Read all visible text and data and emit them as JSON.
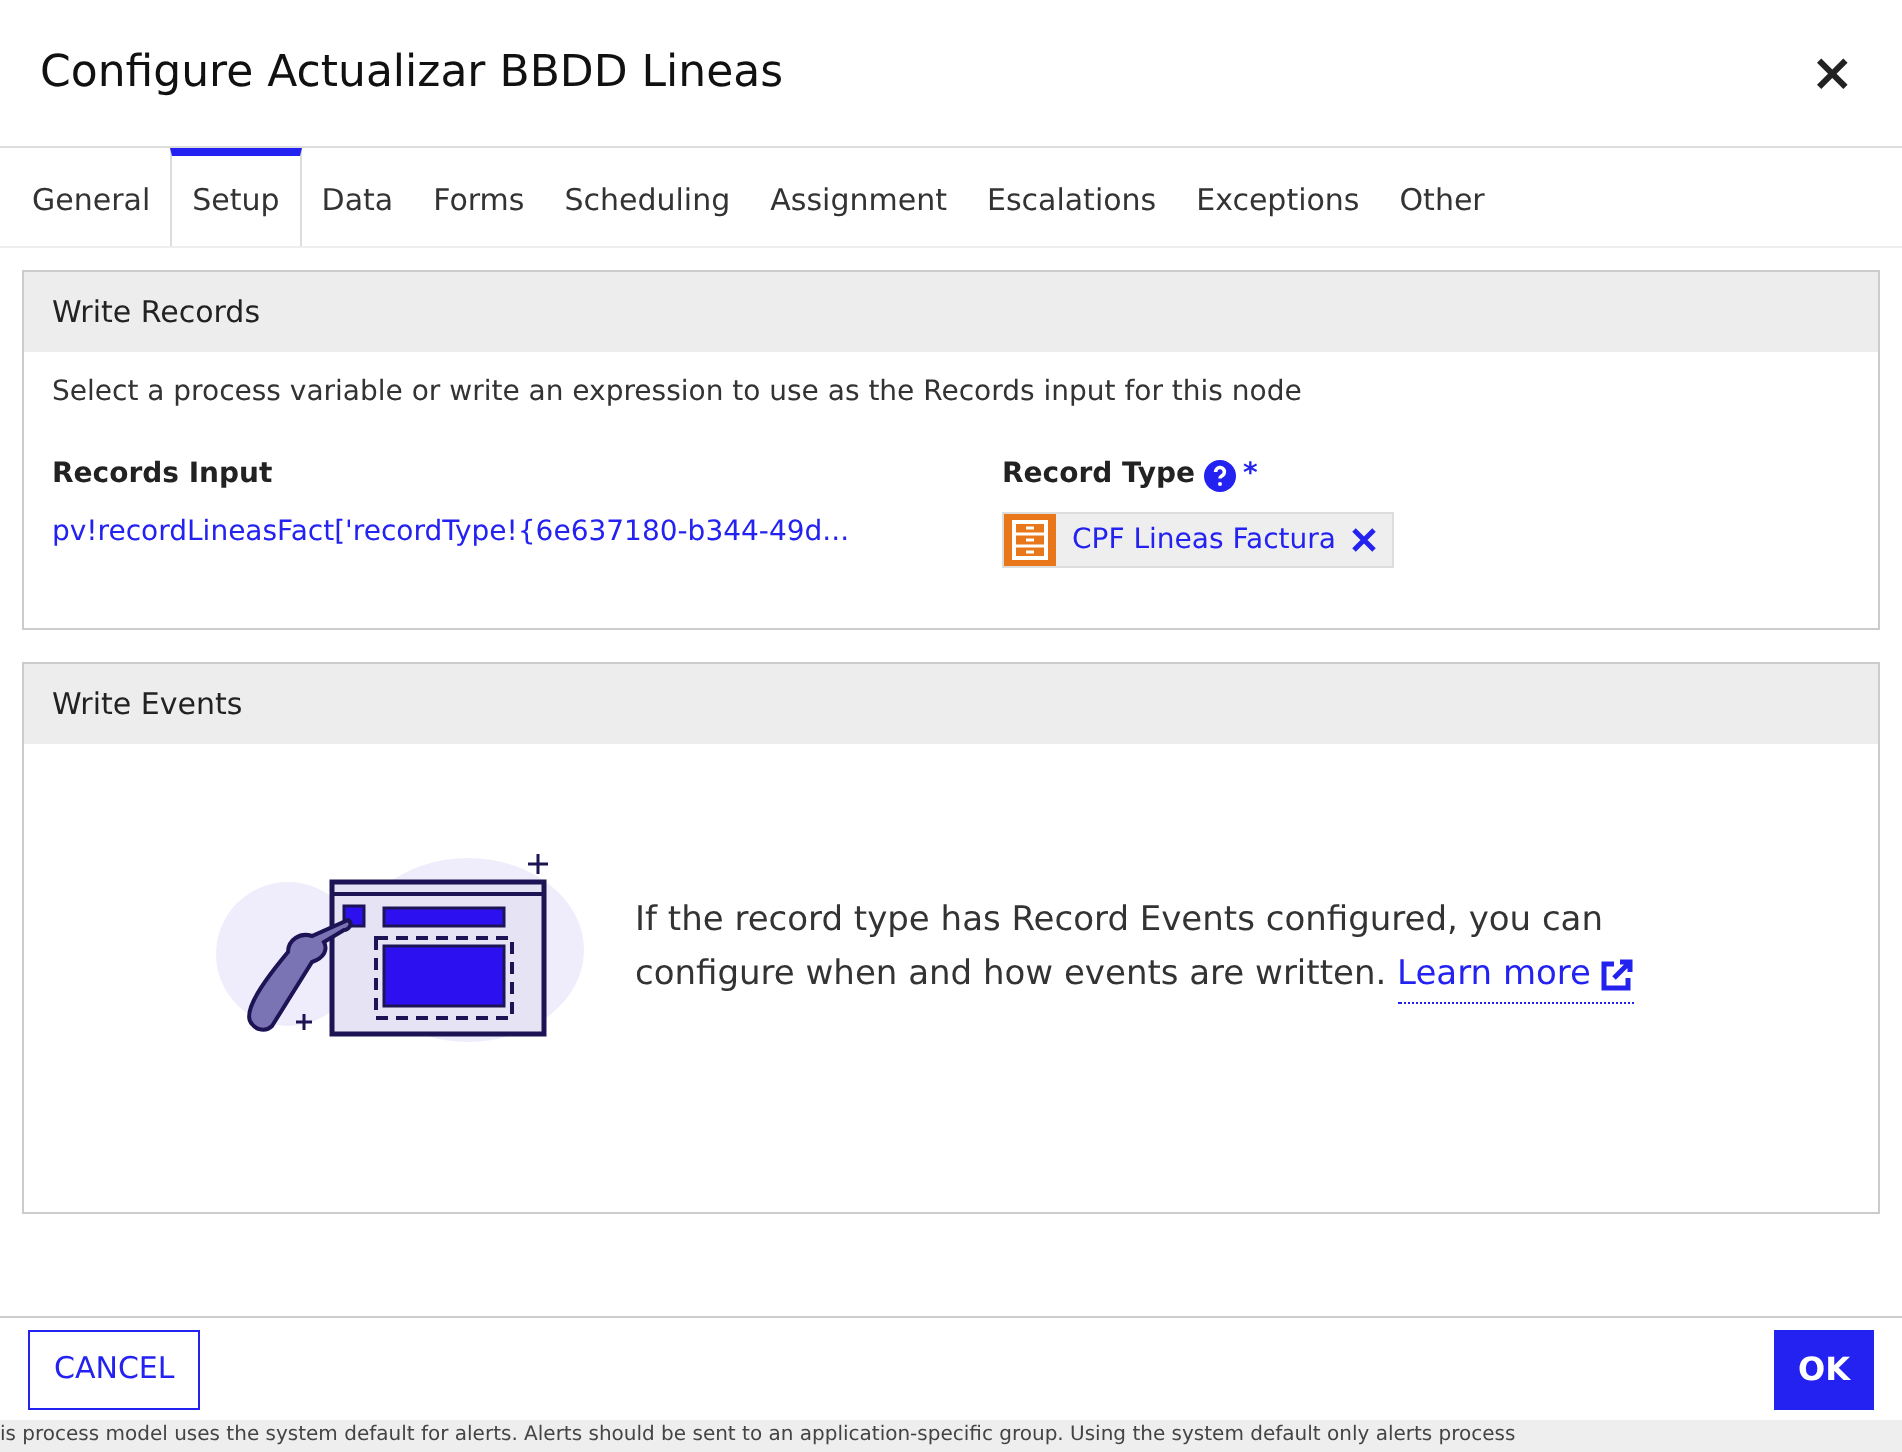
{
  "dialog": {
    "title": "Configure Actualizar BBDD Lineas",
    "close": "×"
  },
  "tabs": [
    {
      "label": "General",
      "selected": false
    },
    {
      "label": "Setup",
      "selected": true
    },
    {
      "label": "Data",
      "selected": false
    },
    {
      "label": "Forms",
      "selected": false
    },
    {
      "label": "Scheduling",
      "selected": false
    },
    {
      "label": "Assignment",
      "selected": false
    },
    {
      "label": "Escalations",
      "selected": false
    },
    {
      "label": "Exceptions",
      "selected": false
    },
    {
      "label": "Other",
      "selected": false
    }
  ],
  "write_records": {
    "title": "Write Records",
    "description": "Select a process variable or write an expression to use as the Records input for this node",
    "records_input": {
      "label": "Records Input",
      "value": "pv!recordLineasFact['recordType!{6e637180-b344-49d..."
    },
    "record_type": {
      "label": "Record Type",
      "required": "*",
      "tag": "CPF Lineas Factura"
    }
  },
  "write_events": {
    "title": "Write Events",
    "message": "If the record type has Record Events configured, you can configure when and how events are written.",
    "link": "Learn more"
  },
  "buttons": {
    "cancel": "CANCEL",
    "ok": "OK"
  },
  "background_text": "is process model uses the system default for alerts. Alerts should be sent to an application-specific group. Using the system default only alerts process"
}
